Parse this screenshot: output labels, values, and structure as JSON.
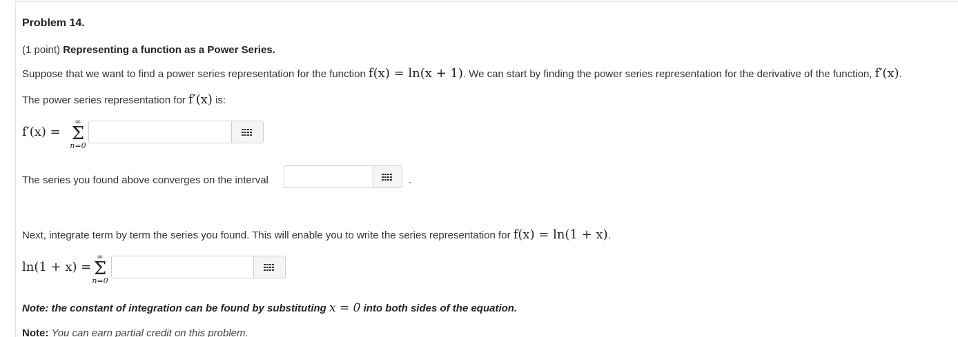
{
  "problem": {
    "title": "Problem 14.",
    "points": "(1 point)",
    "heading": "Representing a function as a Power Series."
  },
  "intro": {
    "text_before": "Suppose that we want to find a power series representation for the function",
    "function": "f(x) = ln(x + 1)",
    "text_after": ". We can start by finding the power series representation for the derivative of the function,",
    "derivative": "f′(x)",
    "end": "."
  },
  "part1": {
    "prompt": "The power series representation for",
    "derivative": "f′(x)",
    "prompt_end": "is:",
    "lhs": "f′(x) =",
    "sum_upper": "∞",
    "sum_lower": "n=0",
    "answer_value": "",
    "equation_button_icon": "grid-icon"
  },
  "part2": {
    "prompt": "The series you found above converges on the interval",
    "answer_value": "",
    "equation_button_icon": "grid-icon",
    "end": "."
  },
  "part3": {
    "text_before": "Next, integrate term by term the series you found. This will enable you to write the series representation for",
    "function": "f(x) = ln(1 + x)",
    "end": ".",
    "lhs": "ln(1 + x) =",
    "sum_upper": "∞",
    "sum_lower": "n=0",
    "answer_value": "",
    "equation_button_icon": "grid-icon"
  },
  "note1": {
    "before": "Note: the constant of integration can be found by substituting",
    "math": "x = 0",
    "after": "into both sides of the equation."
  },
  "note2": {
    "label": "Note",
    "message": "You can earn partial credit on this problem."
  },
  "colors": {
    "text": "#333333",
    "input_border": "#cfcfcf",
    "button_bg": "#f5f5f5"
  }
}
